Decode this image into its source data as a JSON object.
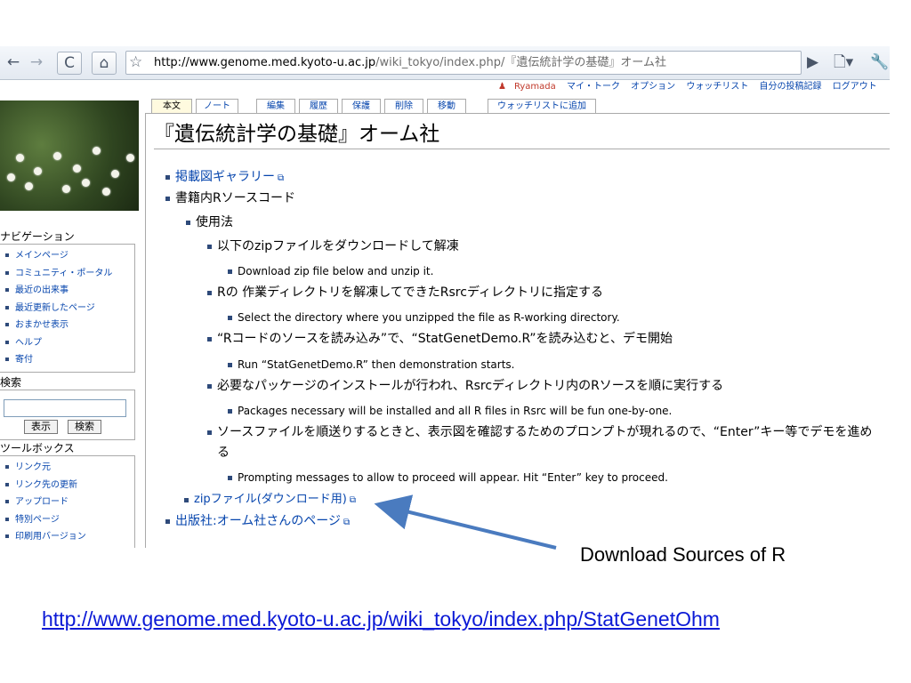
{
  "browser": {
    "back": "←",
    "forward": "→",
    "reload": "C",
    "home": "⌂",
    "star": "☆",
    "url_main": "http://www.genome.med.kyoto-u.ac.jp",
    "url_rest": "/wiki_tokyo/index.php/『遺伝統計学の基礎』オーム社",
    "go": "▶",
    "page_menu": "🗋▾",
    "tools_menu": "🔧"
  },
  "userbar": {
    "user": "Ryamada",
    "items": [
      "マイ・トーク",
      "オプション",
      "ウォッチリスト",
      "自分の投稿記録",
      "ログアウト"
    ]
  },
  "tabs": [
    "本文",
    "ノート",
    "編集",
    "履歴",
    "保護",
    "削除",
    "移動",
    "ウォッチリストに追加"
  ],
  "page": {
    "title": "『遺伝統計学の基礎』オーム社",
    "items": {
      "gallery": "掲載図ギャラリー",
      "source": "書籍内Rソースコード",
      "usage": "使用法",
      "s1_jp": "以下のzipファイルをダウンロードして解凍",
      "s1_en": "Download zip file below and unzip it.",
      "s2_jp": "Rの 作業ディレクトリを解凍してできたRsrcディレクトリに指定する",
      "s2_en": "Select the directory where you unzipped the file as R-working directory.",
      "s3_jp": "“Rコードのソースを読み込み”で、“StatGenetDemo.R”を読み込むと、デモ開始",
      "s3_en": "Run “StatGenetDemo.R” then demonstration starts.",
      "s4_jp": "必要なパッケージのインストールが行われ、Rsrcディレクトリ内のRソースを順に実行する",
      "s4_en": "Packages necessary will be installed and all R files in Rsrc will be fun one-by-one.",
      "s5_jp_1": "ソースファイルを順送りするときと、表示図を確認するためのプロンプトが現れるので、“Enter”キー等でデモを進め",
      "s5_jp_2": "る",
      "s5_en": "Prompting messages to allow to proceed will appear. Hit “Enter” key to proceed.",
      "zip": "zipファイル(ダウンロード用)",
      "publisher": "出版社:オーム社さんのページ"
    }
  },
  "sidebar": {
    "nav_heading": "ナビゲーション",
    "nav_items": [
      "メインページ",
      "コミュニティ・ポータル",
      "最近の出来事",
      "最近更新したページ",
      "おまかせ表示",
      "ヘルプ",
      "寄付"
    ],
    "search_heading": "検索",
    "search_buttons": [
      "表示",
      "検索"
    ],
    "toolbox_heading": "ツールボックス",
    "toolbox_items": [
      "リンク元",
      "リンク先の更新",
      "アップロード",
      "特別ページ",
      "印刷用バージョン"
    ]
  },
  "annotation": "Download Sources of R",
  "bottom_link": "http://www.genome.med.kyoto-u.ac.jp/wiki_tokyo/index.php/StatGenetOhm"
}
